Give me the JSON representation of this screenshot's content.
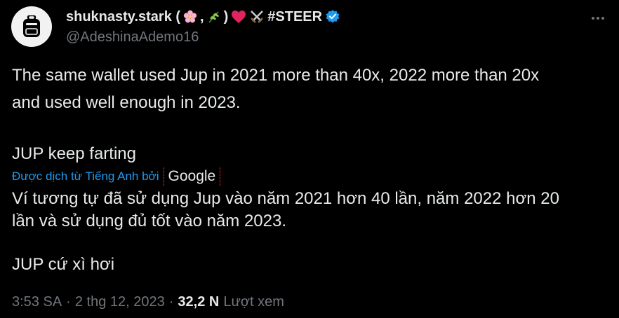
{
  "author": {
    "display_name_prefix": "shuknasty.stark (",
    "display_name_mid1": ",",
    "display_name_mid2": ")",
    "display_name_tag": "#STEER",
    "handle": "@AdeshinaAdemo16",
    "verified_color": "#1d9bf0",
    "icons": [
      "cherry-blossom-icon",
      "herb-icon",
      "red-heart-icon",
      "crossed-swords-icon",
      "verified-badge-icon"
    ]
  },
  "tweet": {
    "line1": "The same wallet used Jup in 2021 more than 40x, 2022 more than 20x",
    "line2": "and used well enough in 2023.",
    "line3": "JUP keep farting"
  },
  "translation": {
    "label": "Được dịch từ Tiếng Anh bởi",
    "provider": "Google",
    "line1": "Ví tương tự đã sử dụng Jup vào năm 2021 hơn 40 lần, năm 2022 hơn 20",
    "line2": "lần và sử dụng đủ tốt vào năm 2023.",
    "line3": "JUP cứ xì hơi"
  },
  "meta": {
    "time": "3:53 SA",
    "separator": "·",
    "date": "2 thg 12, 2023",
    "views_count": "32,2 N",
    "views_label": "Lượt xem"
  },
  "colors": {
    "background": "#000000",
    "text": "#e7e9ea",
    "muted": "#71767b",
    "link": "#1d9bf0"
  }
}
